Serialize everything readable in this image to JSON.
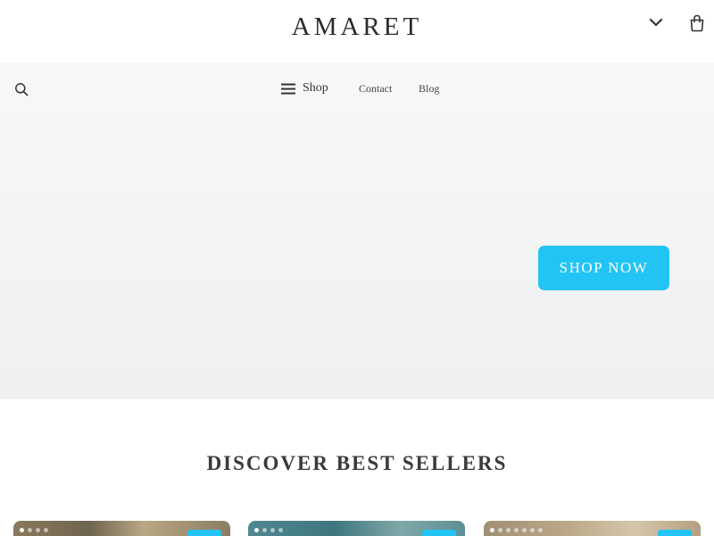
{
  "header": {
    "logo": "AMARET",
    "dropdown_icon": "chevron-down-icon",
    "cart_icon": "shopping-bag-icon"
  },
  "nav": {
    "search_icon": "search-icon",
    "menu_icon": "hamburger-menu-icon",
    "shop": "Shop",
    "contact": "Contact",
    "blog": "Blog"
  },
  "hero": {
    "cta": "SHOP NOW"
  },
  "best_sellers": {
    "title": "DISCOVER BEST SELLERS"
  },
  "colors": {
    "accent": "#22c4f5",
    "text": "#333333",
    "hero_bg": "#f2f3f4"
  }
}
